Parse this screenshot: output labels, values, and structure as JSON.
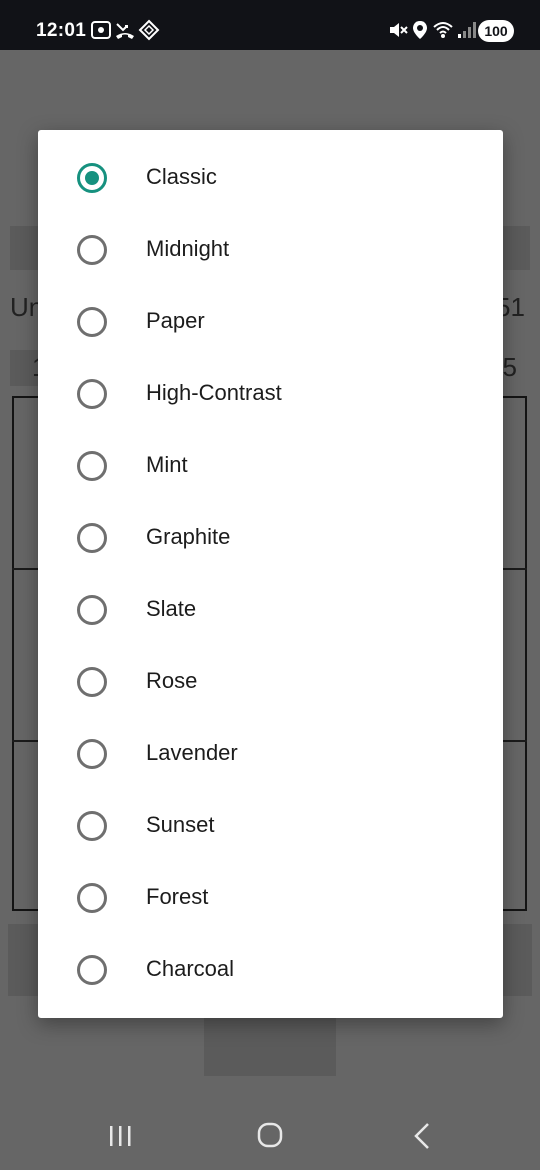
{
  "status_bar": {
    "time": "12:01",
    "battery": "100",
    "icons": [
      "screenshot-icon",
      "missed-call-icon",
      "app-notification-icon",
      "mute-icon",
      "location-icon",
      "wifi-icon",
      "signal-icon"
    ]
  },
  "background": {
    "partial_text": {
      "left_label": "Un",
      "right_number": "51",
      "left_row": "1",
      "right_row": "15"
    }
  },
  "theme_dialog": {
    "selected": "Classic",
    "options": [
      "Classic",
      "Midnight",
      "Paper",
      "High-Contrast",
      "Mint",
      "Graphite",
      "Slate",
      "Rose",
      "Lavender",
      "Sunset",
      "Forest",
      "Charcoal"
    ]
  },
  "colors": {
    "accent": "#16917f",
    "radio_unchecked": "#6f6f6f",
    "status_bar_bg": "#111217"
  },
  "nav_bar": {
    "buttons": [
      "recent-apps-icon",
      "home-icon",
      "back-icon"
    ]
  }
}
